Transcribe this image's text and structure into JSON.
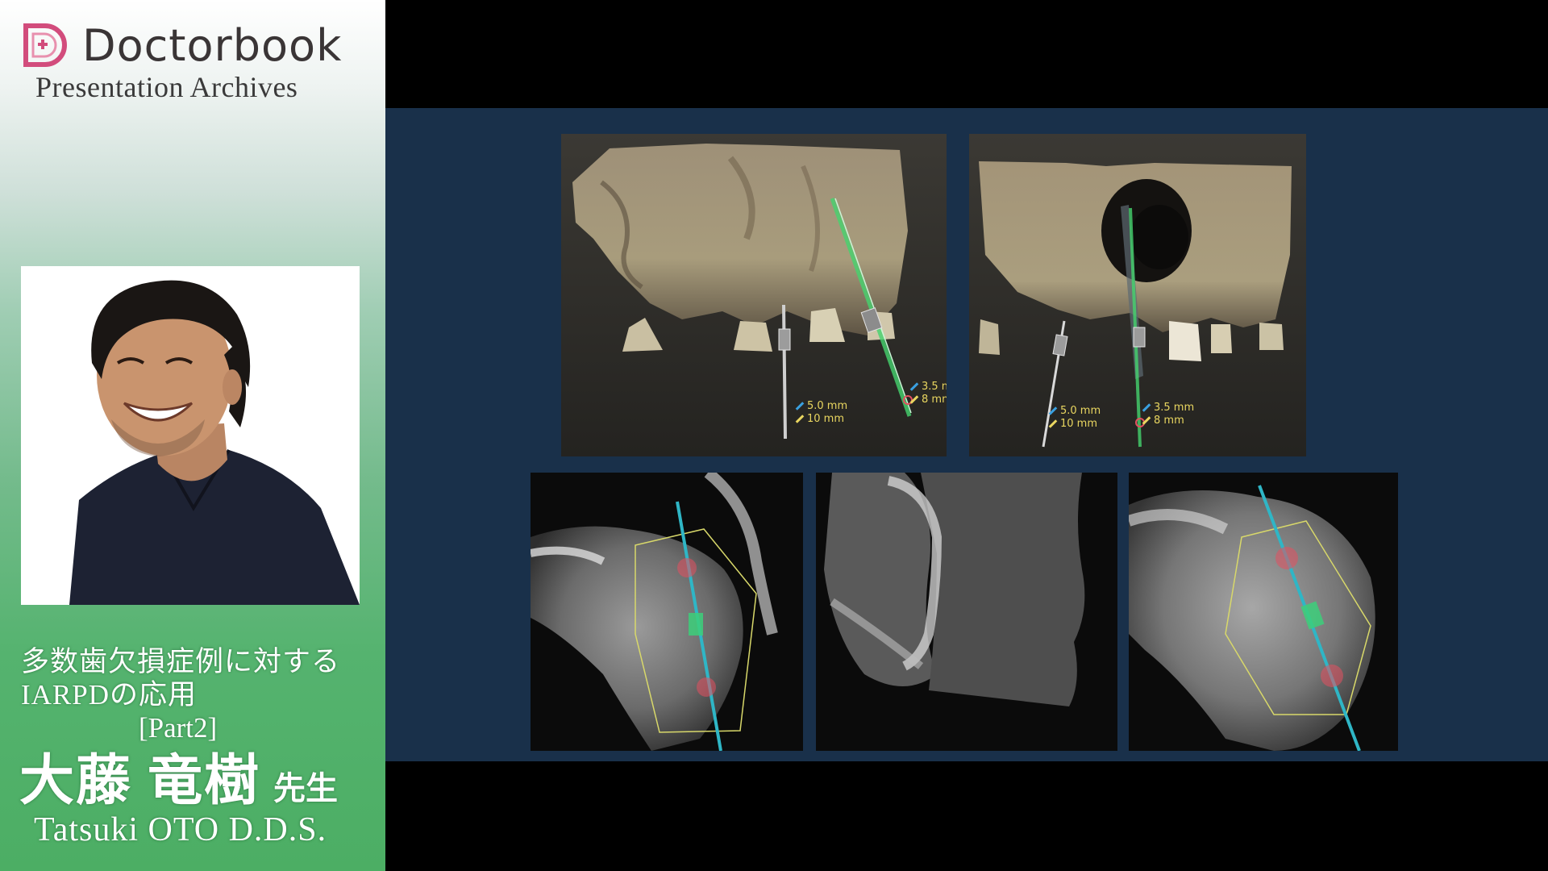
{
  "branding": {
    "name": "Doctorbook",
    "subtitle": "Presentation Archives",
    "logo_color": "#d24c7c"
  },
  "talk": {
    "title_line1": "多数歯欠損症例に対する",
    "title_line2": "IARPDの応用",
    "part": "[Part2]"
  },
  "speaker": {
    "name_ja": "大藤 竜樹",
    "honorific": "先生",
    "name_en": "Tatsuki OTO D.D.S."
  },
  "slide": {
    "background": "#19304a",
    "render_left": {
      "implant_1": {
        "diameter": "5.0 mm",
        "length": "10 mm"
      },
      "implant_2": {
        "diameter": "3.5 n",
        "length": "8 mn"
      }
    },
    "render_right": {
      "implant_1": {
        "diameter": "5.0 mm",
        "length": "10 mm"
      },
      "implant_2": {
        "diameter": "3.5 mm",
        "length": "8 mm"
      }
    }
  },
  "colors": {
    "panel_green_bottom": "#4cae64",
    "measure_text": "#e9d660",
    "guide_cyan": "#2fb6c6",
    "guide_outline": "#d8d86a",
    "implant_green": "#3ccf7a"
  }
}
